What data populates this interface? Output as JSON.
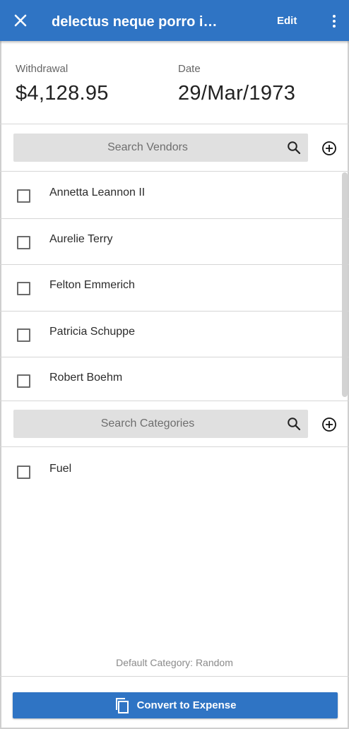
{
  "appbar": {
    "title": "delectus neque porro in ...",
    "edit_label": "Edit",
    "close_icon": "close-icon",
    "more_icon": "more-vertical-icon",
    "color": "#2f74c4"
  },
  "summary": {
    "withdrawal_label": "Withdrawal",
    "withdrawal_value": "$4,128.95",
    "date_label": "Date",
    "date_value": "29/Mar/1973"
  },
  "vendors": {
    "search_placeholder": "Search Vendors",
    "items": [
      {
        "label": "Annetta Leannon II",
        "checked": false
      },
      {
        "label": "Aurelie Terry",
        "checked": false
      },
      {
        "label": "Felton Emmerich",
        "checked": false
      },
      {
        "label": "Patricia Schuppe",
        "checked": false
      },
      {
        "label": "Robert Boehm",
        "checked": false
      }
    ]
  },
  "categories": {
    "search_placeholder": "Search Categories",
    "items": [
      {
        "label": "Fuel",
        "checked": false
      }
    ]
  },
  "footer": {
    "default_category": "Default Category: Random",
    "convert_label": "Convert to Expense",
    "convert_icon": "copy-icon"
  }
}
